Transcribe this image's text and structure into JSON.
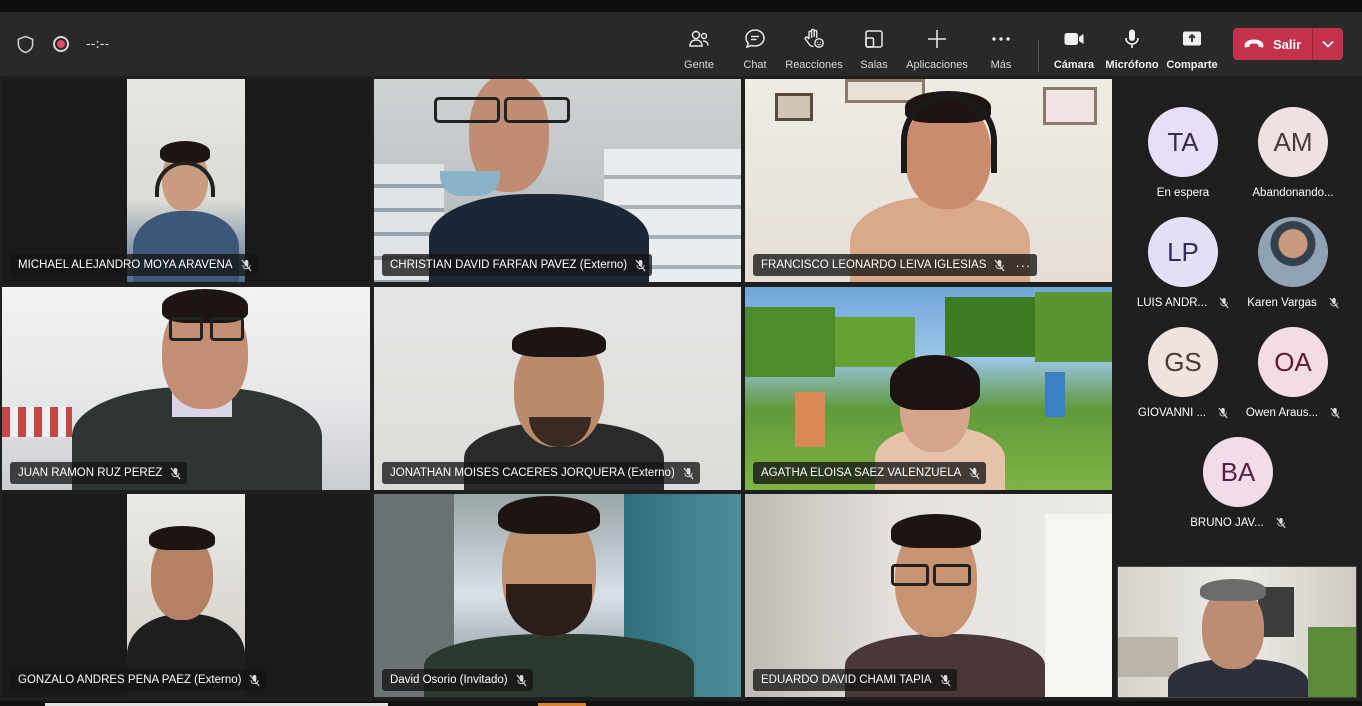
{
  "toolbar": {
    "timer": "--:--",
    "buttons": [
      {
        "id": "people",
        "label": "Gente",
        "icon": "people-icon"
      },
      {
        "id": "chat",
        "label": "Chat",
        "icon": "chat-icon"
      },
      {
        "id": "reactions",
        "label": "Reacciones",
        "icon": "raise-hand-icon"
      },
      {
        "id": "rooms",
        "label": "Salas",
        "icon": "breakout-rooms-icon"
      },
      {
        "id": "apps",
        "label": "Aplicaciones",
        "icon": "plus-icon"
      },
      {
        "id": "more",
        "label": "Más",
        "icon": "more-icon"
      },
      {
        "id": "camera",
        "label": "Cámara",
        "icon": "camera-icon"
      },
      {
        "id": "mic",
        "label": "Micrófono",
        "icon": "microphone-icon"
      },
      {
        "id": "share",
        "label": "Comparte",
        "icon": "share-icon"
      }
    ],
    "leave_label": "Salir",
    "leave_color": "#c4314b"
  },
  "tiles": [
    {
      "name": "MICHAEL ALEJANDRO MOYA ARAVENA"
    },
    {
      "name": "CHRISTIAN DAVID FARFAN PAVEZ (Externo)"
    },
    {
      "name": "FRANCISCO LEONARDO LEIVA IGLESIAS",
      "more": "···"
    },
    {
      "name": "JUAN RAMON RUZ PEREZ"
    },
    {
      "name": "JONATHAN MOISES CACERES JORQUERA (Externo)"
    },
    {
      "name": "AGATHA ELOISA SAEZ VALENZUELA"
    },
    {
      "name": "GONZALO ANDRES PENA PAEZ (Externo)"
    },
    {
      "name": "David Osorio (Invitado)"
    },
    {
      "name": "EDUARDO DAVID CHAMI TAPIA"
    }
  ],
  "roster": [
    {
      "initials": "TA",
      "label": "En espera",
      "muted": false,
      "color": "#e8def5"
    },
    {
      "initials": "AM",
      "label": "Abandonando...",
      "muted": false,
      "color": "#efe1e1"
    },
    {
      "initials": "LP",
      "label": "LUIS ANDR...",
      "muted": true,
      "color": "#e3e0f5"
    },
    {
      "initials": "",
      "label": "Karen Vargas",
      "muted": true,
      "color": "#8a9aa8",
      "photo": true
    },
    {
      "initials": "GS",
      "label": "GIOVANNI ...",
      "muted": true,
      "color": "#efe3df"
    },
    {
      "initials": "OA",
      "label": "Owen Araus...",
      "muted": true,
      "color": "#f3dde2"
    },
    {
      "initials": "BA",
      "label": "BRUNO JAV...",
      "muted": true,
      "color": "#f3dcea"
    }
  ]
}
